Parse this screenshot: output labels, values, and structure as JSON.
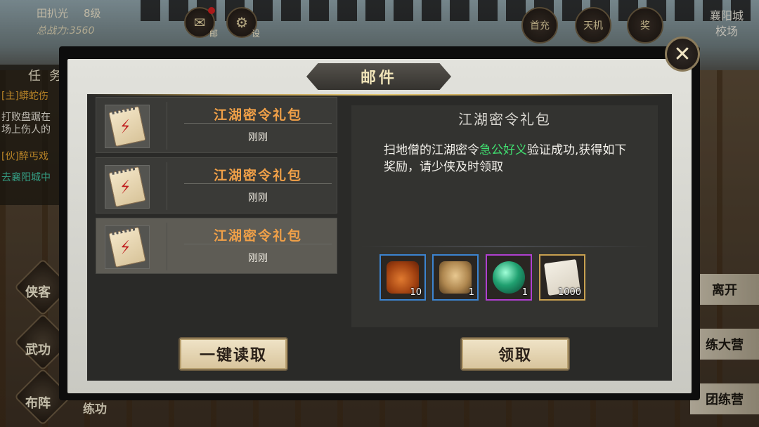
{
  "player": {
    "name": "田扒光",
    "level": "8级",
    "power": "总战力:3560"
  },
  "top_buttons": [
    {
      "label": "邮",
      "icon": "mail-icon",
      "badge": true
    },
    {
      "label": "设",
      "icon": "gear-icon",
      "badge": false
    }
  ],
  "top_right_buttons": [
    "首充",
    "天机",
    "奖"
  ],
  "location": {
    "city": "襄阳城",
    "area": "校场"
  },
  "quest_panel": {
    "title": "任务",
    "lines": [
      {
        "text": "[主]蟒蛇伤",
        "color": "#e0a030"
      },
      {
        "text": "打败盘踞在",
        "color": "#e8e4da"
      },
      {
        "text": "场上伤人的",
        "color": "#e8e4da"
      },
      {
        "text": "[伙]醉丐戏",
        "color": "#e0a030"
      },
      {
        "text": "去襄阳城中",
        "color": "#40c0a0"
      }
    ]
  },
  "left_menu": [
    "侠客",
    "武功",
    "布阵"
  ],
  "right_menu": [
    "离开",
    "练大营",
    "团练营"
  ],
  "bottom_label": "练功",
  "modal": {
    "title": "邮件",
    "close_symbol": "✕",
    "mails": [
      {
        "title": "江湖密令礼包",
        "time": "刚刚",
        "selected": false
      },
      {
        "title": "江湖密令礼包",
        "time": "刚刚",
        "selected": false
      },
      {
        "title": "江湖密令礼包",
        "time": "刚刚",
        "selected": true
      }
    ],
    "detail": {
      "title": "江湖密令礼包",
      "body_prefix": "扫地僧的江湖密令",
      "body_highlight": "急公好义",
      "body_suffix": "验证成功,获得如下奖励，请少侠及时领取",
      "highlight_color": "#40e070"
    },
    "rewards": [
      {
        "name": "roast-chicken",
        "count": "10",
        "rarity": "blue"
      },
      {
        "name": "ginseng-root",
        "count": "1",
        "rarity": "blue"
      },
      {
        "name": "jade-orb",
        "count": "1",
        "rarity": "purple"
      },
      {
        "name": "silver-notes",
        "count": "1000",
        "rarity": "gold"
      }
    ],
    "read_all_label": "一键读取",
    "claim_label": "领取"
  }
}
